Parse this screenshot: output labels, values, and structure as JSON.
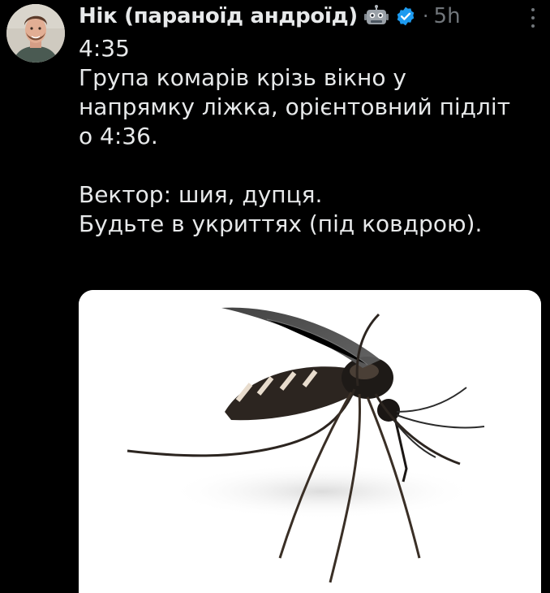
{
  "post": {
    "author_name": "Нік (параноїд андроїд)",
    "author_badge_icon": "robot-icon",
    "verified_icon": "verified-icon",
    "separator": "·",
    "time_ago": "5h",
    "more_icon": "more-vertical-icon",
    "text_lines": [
      "4:35",
      "Група комарів крізь вікно у",
      "напрямку ліжка, орієнтовний підліт",
      "о 4:36."
    ],
    "text_lines_2": [
      "Вектор: шия, дупця.",
      "Будьте в укриттях (під ковдрою)."
    ],
    "media_icon": "mosquito-photo"
  },
  "colors": {
    "background": "#000000",
    "text": "#e7e9ea",
    "muted": "#71767b",
    "verified": "#1d9bf0"
  }
}
